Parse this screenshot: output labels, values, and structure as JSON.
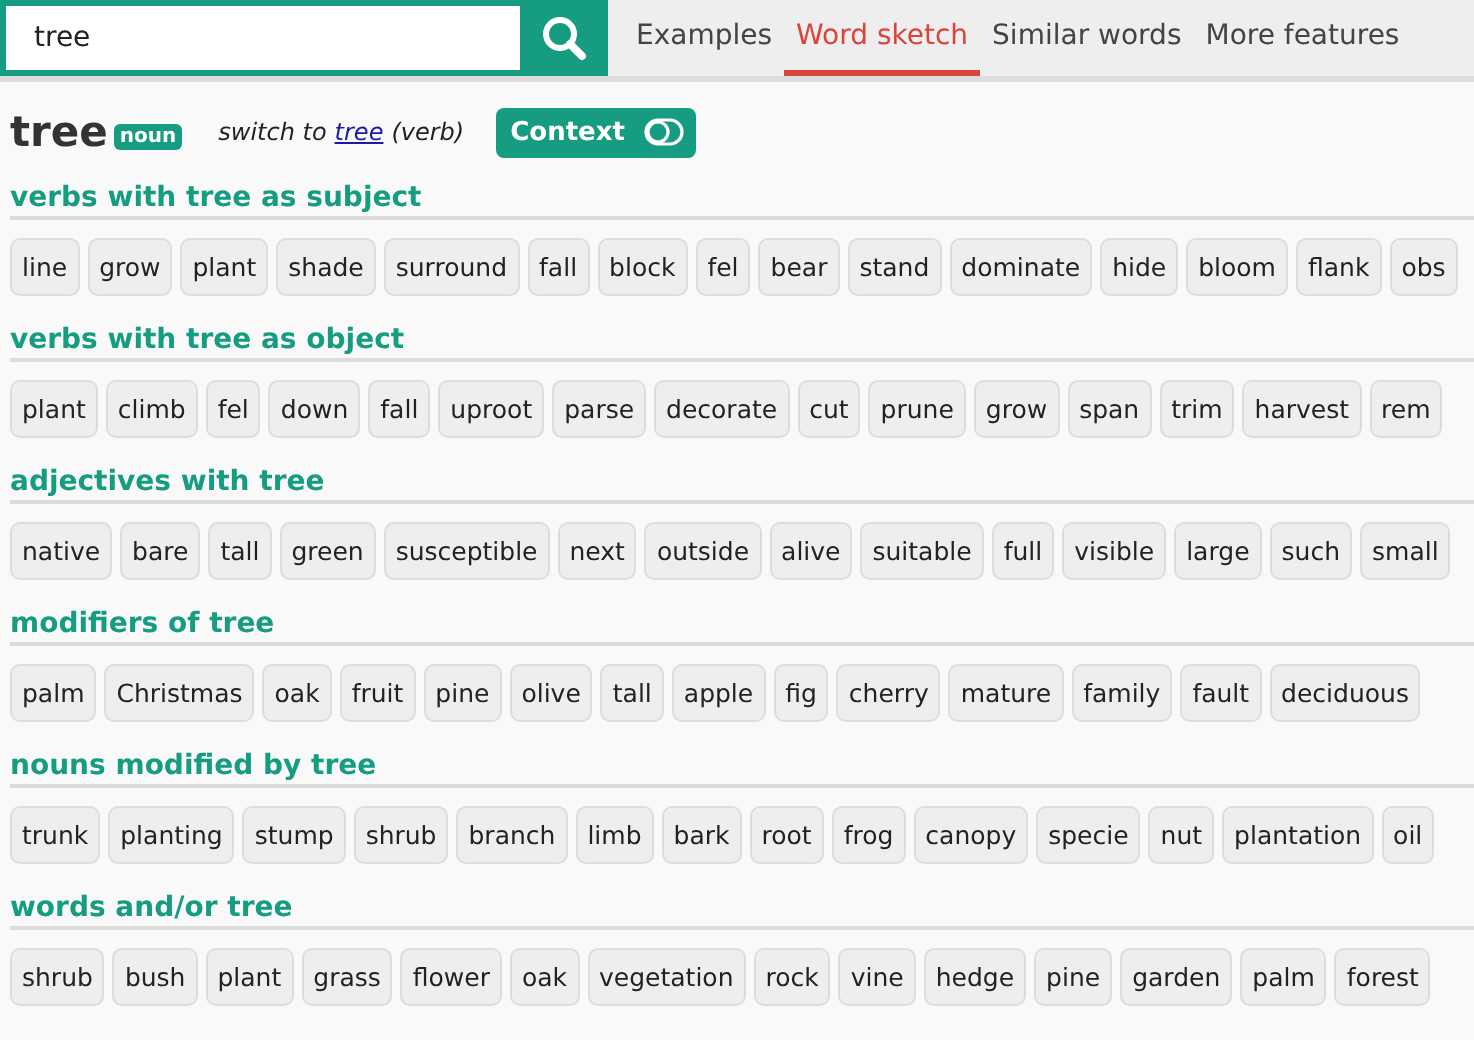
{
  "search": {
    "value": "tree"
  },
  "tabs": [
    {
      "label": "Examples",
      "selected": false
    },
    {
      "label": "Word sketch",
      "selected": true
    },
    {
      "label": "Similar words",
      "selected": false
    },
    {
      "label": "More features",
      "selected": false
    }
  ],
  "headword": {
    "word": "tree",
    "pos": "noun",
    "switch_prefix": "switch to",
    "switch_link": "tree",
    "switch_suffix": "(verb)"
  },
  "context_toggle": {
    "label": "Context",
    "on": false
  },
  "sections": [
    {
      "title": "verbs with tree as subject",
      "words": [
        "line",
        "grow",
        "plant",
        "shade",
        "surround",
        "fall",
        "block",
        "fel",
        "bear",
        "stand",
        "dominate",
        "hide",
        "bloom",
        "flank",
        "obs"
      ]
    },
    {
      "title": "verbs with tree as object",
      "words": [
        "plant",
        "climb",
        "fel",
        "down",
        "fall",
        "uproot",
        "parse",
        "decorate",
        "cut",
        "prune",
        "grow",
        "span",
        "trim",
        "harvest",
        "rem"
      ]
    },
    {
      "title": "adjectives with tree",
      "words": [
        "native",
        "bare",
        "tall",
        "green",
        "susceptible",
        "next",
        "outside",
        "alive",
        "suitable",
        "full",
        "visible",
        "large",
        "such",
        "small"
      ]
    },
    {
      "title": "modifiers of tree",
      "words": [
        "palm",
        "Christmas",
        "oak",
        "fruit",
        "pine",
        "olive",
        "tall",
        "apple",
        "fig",
        "cherry",
        "mature",
        "family",
        "fault",
        "deciduous"
      ]
    },
    {
      "title": "nouns modified by tree",
      "words": [
        "trunk",
        "planting",
        "stump",
        "shrub",
        "branch",
        "limb",
        "bark",
        "root",
        "frog",
        "canopy",
        "specie",
        "nut",
        "plantation",
        "oil"
      ]
    },
    {
      "title": "words and/or tree",
      "words": [
        "shrub",
        "bush",
        "plant",
        "grass",
        "flower",
        "oak",
        "vegetation",
        "rock",
        "vine",
        "hedge",
        "pine",
        "garden",
        "palm",
        "forest"
      ]
    }
  ]
}
